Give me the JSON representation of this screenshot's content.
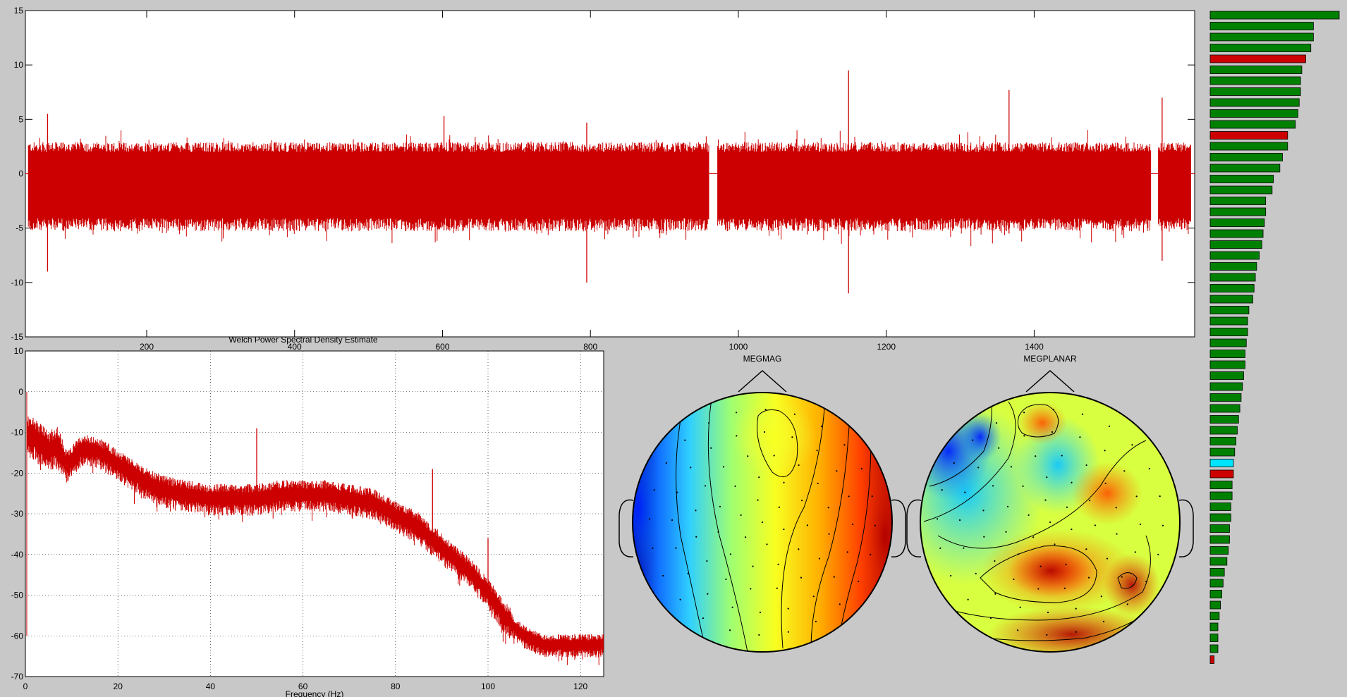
{
  "colors": {
    "figure_bg": "#c8c8c8",
    "axes_bg": "#ffffff",
    "trace": "#cc0000",
    "bar_good": "#008000",
    "bar_bad": "#cc0000",
    "bar_selected": "#00e5ff"
  },
  "chart_data": [
    {
      "type": "line",
      "panel": "time-series",
      "title": "",
      "xlabel": "",
      "ylabel": "",
      "xlim": [
        36,
        1617
      ],
      "ylim": [
        -15,
        15
      ],
      "xticks": [
        200,
        400,
        600,
        800,
        1000,
        1200,
        1400
      ],
      "yticks": [
        15,
        10,
        5,
        0,
        -5,
        -10,
        -15
      ],
      "grid": false,
      "segments": [
        [
          40,
          960
        ],
        [
          972,
          1558
        ],
        [
          1568,
          1612
        ]
      ],
      "typical_envelope": [
        -5,
        2.5
      ],
      "spikes": [
        {
          "x": 66,
          "y_max": 5.5,
          "y_min": -9
        },
        {
          "x": 602,
          "y_max": 5.3,
          "y_min": -5.2
        },
        {
          "x": 795,
          "y_max": 4.7,
          "y_min": -10
        },
        {
          "x": 1149,
          "y_max": 9.5,
          "y_min": -11
        },
        {
          "x": 1366,
          "y_max": 7.7,
          "y_min": -5.5
        },
        {
          "x": 1573,
          "y_max": 7,
          "y_min": -8
        }
      ]
    },
    {
      "type": "line",
      "panel": "psd",
      "title": "Welch Power Spectral Density Estimate",
      "xlabel": "Frequency (Hz)",
      "ylabel": "",
      "xlim": [
        0,
        125
      ],
      "ylim": [
        -70,
        10
      ],
      "xticks": [
        0,
        20,
        40,
        60,
        80,
        100,
        120
      ],
      "yticks": [
        10,
        0,
        -10,
        -20,
        -30,
        -40,
        -50,
        -60,
        -70
      ],
      "grid": true,
      "curve": {
        "x": [
          0.5,
          2,
          5,
          7,
          9,
          12,
          15,
          18,
          22,
          26,
          30,
          35,
          40,
          45,
          50,
          55,
          60,
          65,
          70,
          75,
          80,
          85,
          88,
          92,
          96,
          100,
          103,
          106,
          108,
          110,
          112,
          115,
          120,
          125
        ],
        "y": [
          -10,
          -11,
          -14,
          -13,
          -18,
          -14,
          -14,
          -16,
          -19,
          -22,
          -24,
          -25,
          -26,
          -26,
          -26,
          -25,
          -25,
          -25,
          -26,
          -27,
          -30,
          -33,
          -36,
          -40,
          -44,
          -49,
          -54,
          -58,
          -60,
          -61,
          -62,
          -62,
          -62,
          -62
        ]
      },
      "line_peaks": [
        {
          "freq": 50,
          "power": -9
        },
        {
          "freq": 88,
          "power": -19
        },
        {
          "freq": 100,
          "power": -36
        }
      ]
    },
    {
      "type": "heatmap",
      "panel": "topomap",
      "title": "MEGMAG",
      "colormap": "jet",
      "pattern": "left-right gradient, blue on the left hemisphere to red on the right"
    },
    {
      "type": "heatmap",
      "panel": "topomap",
      "title": "MEGPLANAR",
      "colormap": "jet",
      "pattern": "blue upper-left, red/dark-red central and posterior regions"
    },
    {
      "type": "bar",
      "panel": "channel-variance",
      "orientation": "horizontal",
      "sorted": "descending",
      "values": [
        1.0,
        0.8,
        0.8,
        0.78,
        0.74,
        0.71,
        0.7,
        0.7,
        0.69,
        0.68,
        0.66,
        0.6,
        0.6,
        0.56,
        0.54,
        0.49,
        0.48,
        0.43,
        0.43,
        0.42,
        0.41,
        0.4,
        0.38,
        0.36,
        0.35,
        0.34,
        0.33,
        0.3,
        0.29,
        0.29,
        0.28,
        0.27,
        0.27,
        0.26,
        0.25,
        0.24,
        0.23,
        0.22,
        0.21,
        0.2,
        0.19,
        0.18,
        0.18,
        0.17,
        0.17,
        0.16,
        0.16,
        0.15,
        0.15,
        0.14,
        0.13,
        0.11,
        0.1,
        0.09,
        0.08,
        0.07,
        0.06,
        0.06,
        0.06,
        0.03
      ],
      "status": [
        "good",
        "good",
        "good",
        "good",
        "bad",
        "good",
        "good",
        "good",
        "good",
        "good",
        "good",
        "bad",
        "good",
        "good",
        "good",
        "good",
        "good",
        "good",
        "good",
        "good",
        "good",
        "good",
        "good",
        "good",
        "good",
        "good",
        "good",
        "good",
        "good",
        "good",
        "good",
        "good",
        "good",
        "good",
        "good",
        "good",
        "good",
        "good",
        "good",
        "good",
        "good",
        "selected",
        "bad",
        "good",
        "good",
        "good",
        "good",
        "good",
        "good",
        "good",
        "good",
        "good",
        "good",
        "good",
        "good",
        "good",
        "good",
        "good",
        "good",
        "bad"
      ]
    }
  ]
}
